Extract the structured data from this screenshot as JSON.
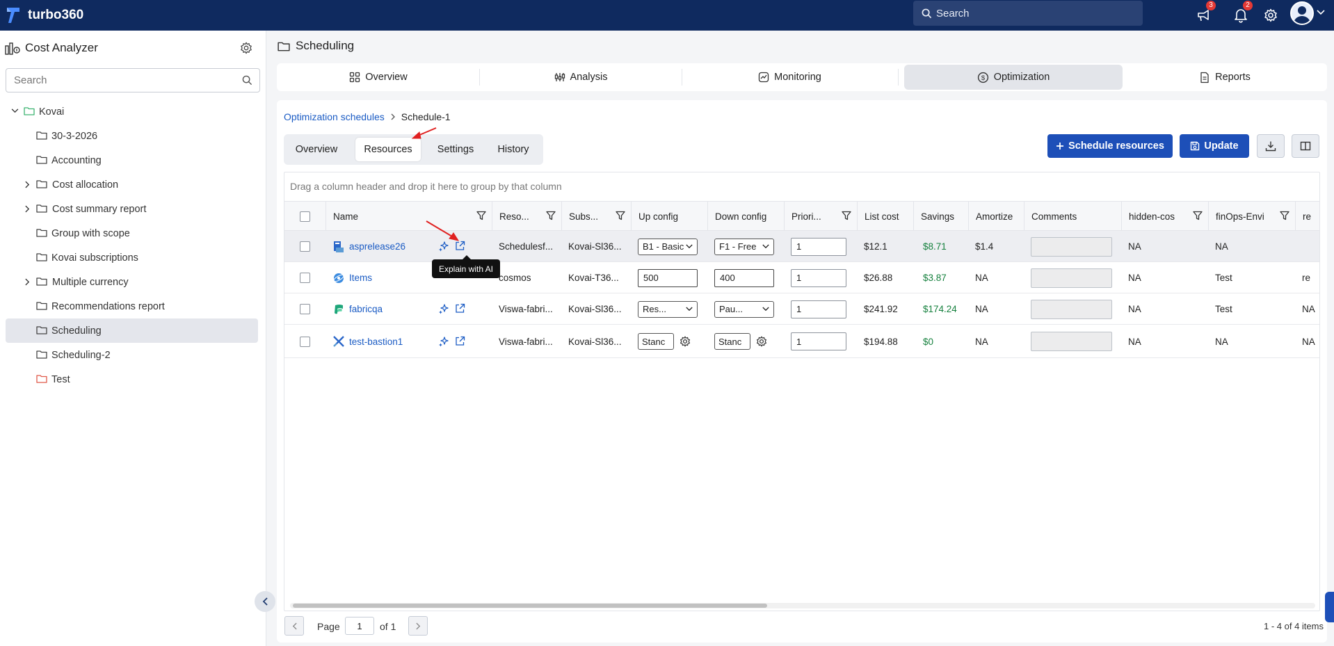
{
  "topbar": {
    "app_name": "turbo360",
    "search_label": "Search",
    "announcements_count": "3",
    "notifications_count": "2"
  },
  "sidebar": {
    "title": "Cost Analyzer",
    "search_placeholder": "Search",
    "root": "Kovai",
    "items": [
      {
        "label": "30-3-2026"
      },
      {
        "label": "Accounting"
      },
      {
        "label": "Cost allocation"
      },
      {
        "label": "Cost summary report"
      },
      {
        "label": "Group with scope"
      },
      {
        "label": "Kovai subscriptions"
      },
      {
        "label": "Multiple currency"
      },
      {
        "label": "Recommendations report"
      },
      {
        "label": "Scheduling"
      },
      {
        "label": "Scheduling-2"
      },
      {
        "label": "Test"
      }
    ]
  },
  "page": {
    "title": "Scheduling"
  },
  "main_tabs": [
    {
      "label": "Overview"
    },
    {
      "label": "Analysis"
    },
    {
      "label": "Monitoring"
    },
    {
      "label": "Optimization"
    },
    {
      "label": "Reports"
    }
  ],
  "breadcrumb": {
    "parent": "Optimization schedules",
    "current": "Schedule-1"
  },
  "sub_tabs": [
    {
      "label": "Overview"
    },
    {
      "label": "Resources"
    },
    {
      "label": "Settings"
    },
    {
      "label": "History"
    }
  ],
  "actions": {
    "schedule_resources": "Schedule resources",
    "update": "Update"
  },
  "grid": {
    "group_hint": "Drag a column header and drop it here to group by that column",
    "columns": [
      "Name",
      "Reso...",
      "Subs...",
      "Up config",
      "Down config",
      "Priori...",
      "List cost",
      "Savings",
      "Amortize",
      "Comments",
      "hidden-cos",
      "finOps-Envi",
      "re"
    ],
    "tooltip": "Explain with AI",
    "rows": [
      {
        "name": "asprelease26",
        "resource_group": "Schedulesf...",
        "subscription": "Kovai-Sl36...",
        "up_config": "B1 - Basic",
        "down_config": "F1 - Free",
        "priority": "1",
        "list_cost": "$12.1",
        "savings": "$8.71",
        "amortize": "$1.4",
        "hidden_cost": "NA",
        "finops_env": "NA",
        "extra": ""
      },
      {
        "name": "Items",
        "resource_group": "cosmos",
        "subscription": "Kovai-T36...",
        "up_config": "500",
        "down_config": "400",
        "priority": "1",
        "list_cost": "$26.88",
        "savings": "$3.87",
        "amortize": "NA",
        "hidden_cost": "NA",
        "finops_env": "Test",
        "extra": "re"
      },
      {
        "name": "fabricqa",
        "resource_group": "Viswa-fabri...",
        "subscription": "Kovai-Sl36...",
        "up_config": "Res...",
        "down_config": "Pau...",
        "priority": "1",
        "list_cost": "$241.92",
        "savings": "$174.24",
        "amortize": "NA",
        "hidden_cost": "NA",
        "finops_env": "Test",
        "extra": "NA"
      },
      {
        "name": "test-bastion1",
        "resource_group": "Viswa-fabri...",
        "subscription": "Kovai-Sl36...",
        "up_config": "Stanc",
        "down_config": "Stanc",
        "priority": "1",
        "list_cost": "$194.88",
        "savings": "$0",
        "amortize": "NA",
        "hidden_cost": "NA",
        "finops_env": "NA",
        "extra": "NA"
      }
    ]
  },
  "pager": {
    "page_label": "Page",
    "page_value": "1",
    "of_label": "of 1",
    "items_info": "1 - 4 of 4 items"
  },
  "colors": {
    "topbar": "#0f2a5f",
    "primary": "#1d4fb8",
    "link": "#1a5bc4",
    "savings": "#15803d",
    "root_folder": "#3cb371",
    "test_folder": "#e05a4a",
    "annotation": "#e02020"
  },
  "icons": [
    "turbo360-logo-icon",
    "search-icon",
    "megaphone-icon",
    "bell-icon",
    "gear-icon",
    "user-avatar-icon",
    "folder-icon",
    "chevron-icon",
    "filter-icon",
    "ai-sparkle-icon",
    "external-link-icon",
    "download-icon",
    "columns-icon",
    "save-icon",
    "plus-icon"
  ]
}
